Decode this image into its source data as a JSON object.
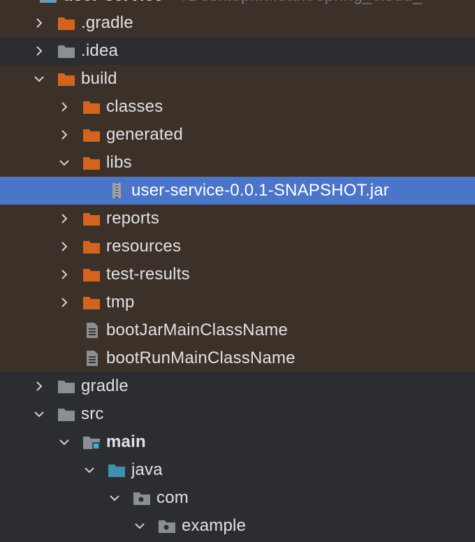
{
  "root": {
    "name": "user-service",
    "path": "~/Desktop/inflearn/spring_cloud_"
  },
  "rows": [
    {
      "label": ".gradle"
    },
    {
      "label": ".idea"
    },
    {
      "label": "build"
    },
    {
      "label": "classes"
    },
    {
      "label": "generated"
    },
    {
      "label": "libs"
    },
    {
      "label": "user-service-0.0.1-SNAPSHOT.jar"
    },
    {
      "label": "reports"
    },
    {
      "label": "resources"
    },
    {
      "label": "test-results"
    },
    {
      "label": "tmp"
    },
    {
      "label": "bootJarMainClassName"
    },
    {
      "label": "bootRunMainClassName"
    },
    {
      "label": "gradle"
    },
    {
      "label": "src"
    },
    {
      "label": "main"
    },
    {
      "label": "java"
    },
    {
      "label": "com"
    },
    {
      "label": "example"
    }
  ],
  "colors": {
    "excluded_bg": "#3c3129",
    "selected_bg": "#4a75c9",
    "panel_bg": "#2b2d30",
    "excluded_folder": "#d2641f",
    "plain_folder": "#8a8f96",
    "source_folder": "#3f8fb0"
  }
}
